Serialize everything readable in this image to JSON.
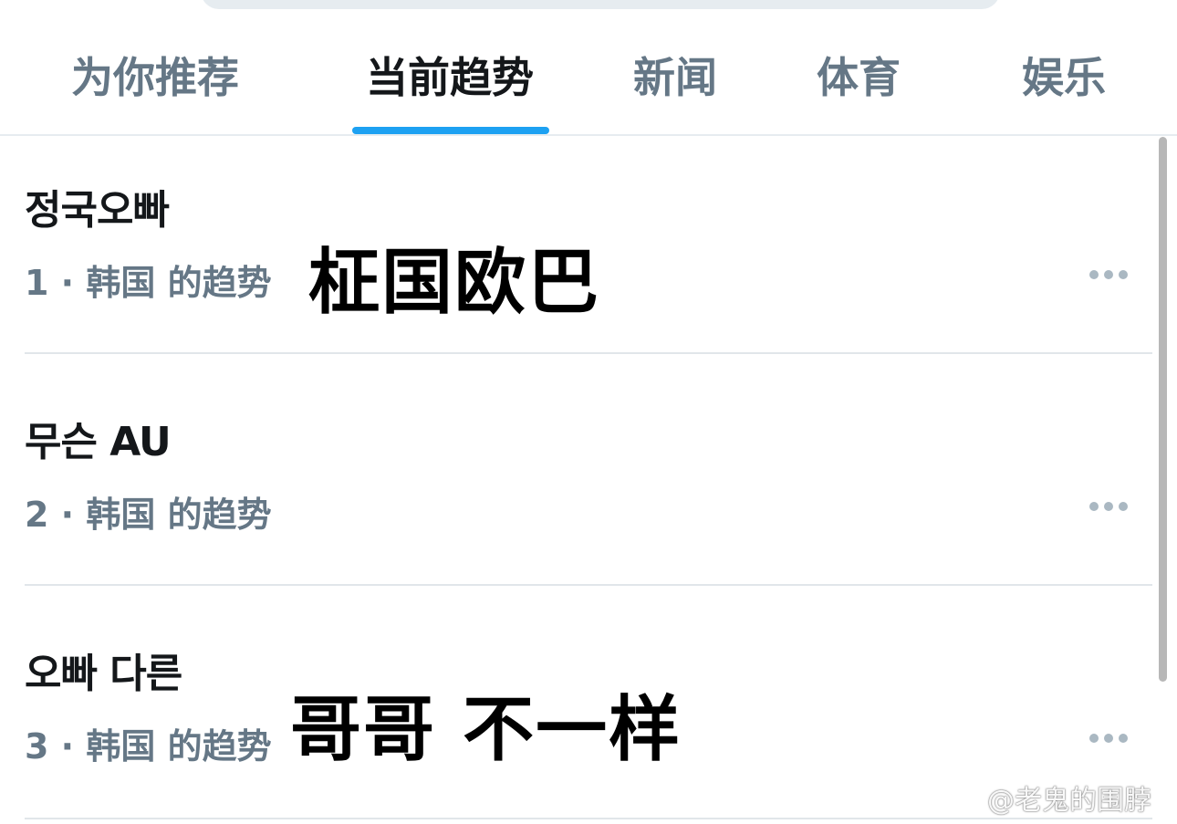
{
  "tabs": [
    {
      "label": "为你推荐",
      "active": false
    },
    {
      "label": "当前趋势",
      "active": true
    },
    {
      "label": "新闻",
      "active": false
    },
    {
      "label": "体育",
      "active": false
    },
    {
      "label": "娱乐",
      "active": false
    }
  ],
  "trends": [
    {
      "name": "정국오빠",
      "meta": "1 · 韩国 的趋势",
      "caption": "柾国欧巴"
    },
    {
      "name": "무슨 AU",
      "meta": "2 · 韩国 的趋势",
      "caption": ""
    },
    {
      "name": "오빠 다른",
      "meta": "3 · 韩国 的趋势",
      "caption": "哥哥 不一样"
    }
  ],
  "watermark": {
    "text": "@老鬼的围脖",
    "icon": "weibo-icon"
  },
  "colors": {
    "accent": "#1da1f2",
    "primary_text": "#14171a",
    "secondary_text": "#657786",
    "divider": "#e1e6ea"
  }
}
